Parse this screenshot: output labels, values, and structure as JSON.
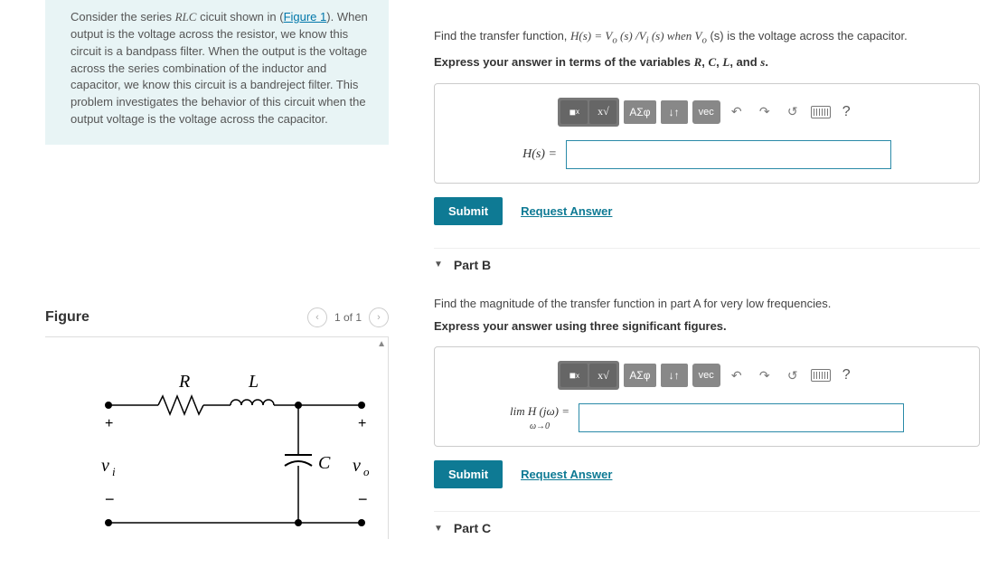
{
  "intro": {
    "text_before_link": "Consider the series ",
    "rlc": "RLC",
    "text_after_rlc": " cicuit shown in (",
    "figure_link": "Figure 1",
    "text_after_link": "). When output is the voltage across the resistor, we know this circuit is a bandpass filter. When the output is the voltage across the series combination of the inductor and capacitor, we know this circuit is a bandreject filter. This problem investigates the behavior of this circuit when the output voltage is the voltage across the capacitor."
  },
  "figure": {
    "title": "Figure",
    "counter": "1 of 1",
    "labels": {
      "R": "R",
      "L": "L",
      "C": "C",
      "vi": "v",
      "vi_sub": "i",
      "vo": "v",
      "vo_sub": "o",
      "plus": "+",
      "minus": "−"
    }
  },
  "partA": {
    "q_prefix": "Find the transfer function, ",
    "q_hs": "H(s) = V",
    "q_o": "o",
    "q_mid1": " (s) /V",
    "q_i": "i",
    "q_mid2": " (s) when V",
    "q_o2": "o",
    "q_end": " (s) is the voltage across the capacitor.",
    "instruction": "Express your answer in terms of the variables R, C, L, and s.",
    "label": "H(s) =",
    "submit": "Submit",
    "request": "Request Answer"
  },
  "partB": {
    "title": "Part B",
    "question": "Find the magnitude of the transfer function in part A for very low frequencies.",
    "instruction": "Express your answer using three significant figures.",
    "label_top": "lim H (jω) =",
    "label_bottom": "ω→0",
    "submit": "Submit",
    "request": "Request Answer"
  },
  "partC": {
    "title": "Part C"
  },
  "toolbar": {
    "templates_icon": "■",
    "sqrt_icon": "√",
    "greek": "ΑΣφ",
    "subscript": "↓↑",
    "vec": "vec",
    "undo": "↶",
    "redo": "↷",
    "reset": "↺",
    "help": "?"
  }
}
